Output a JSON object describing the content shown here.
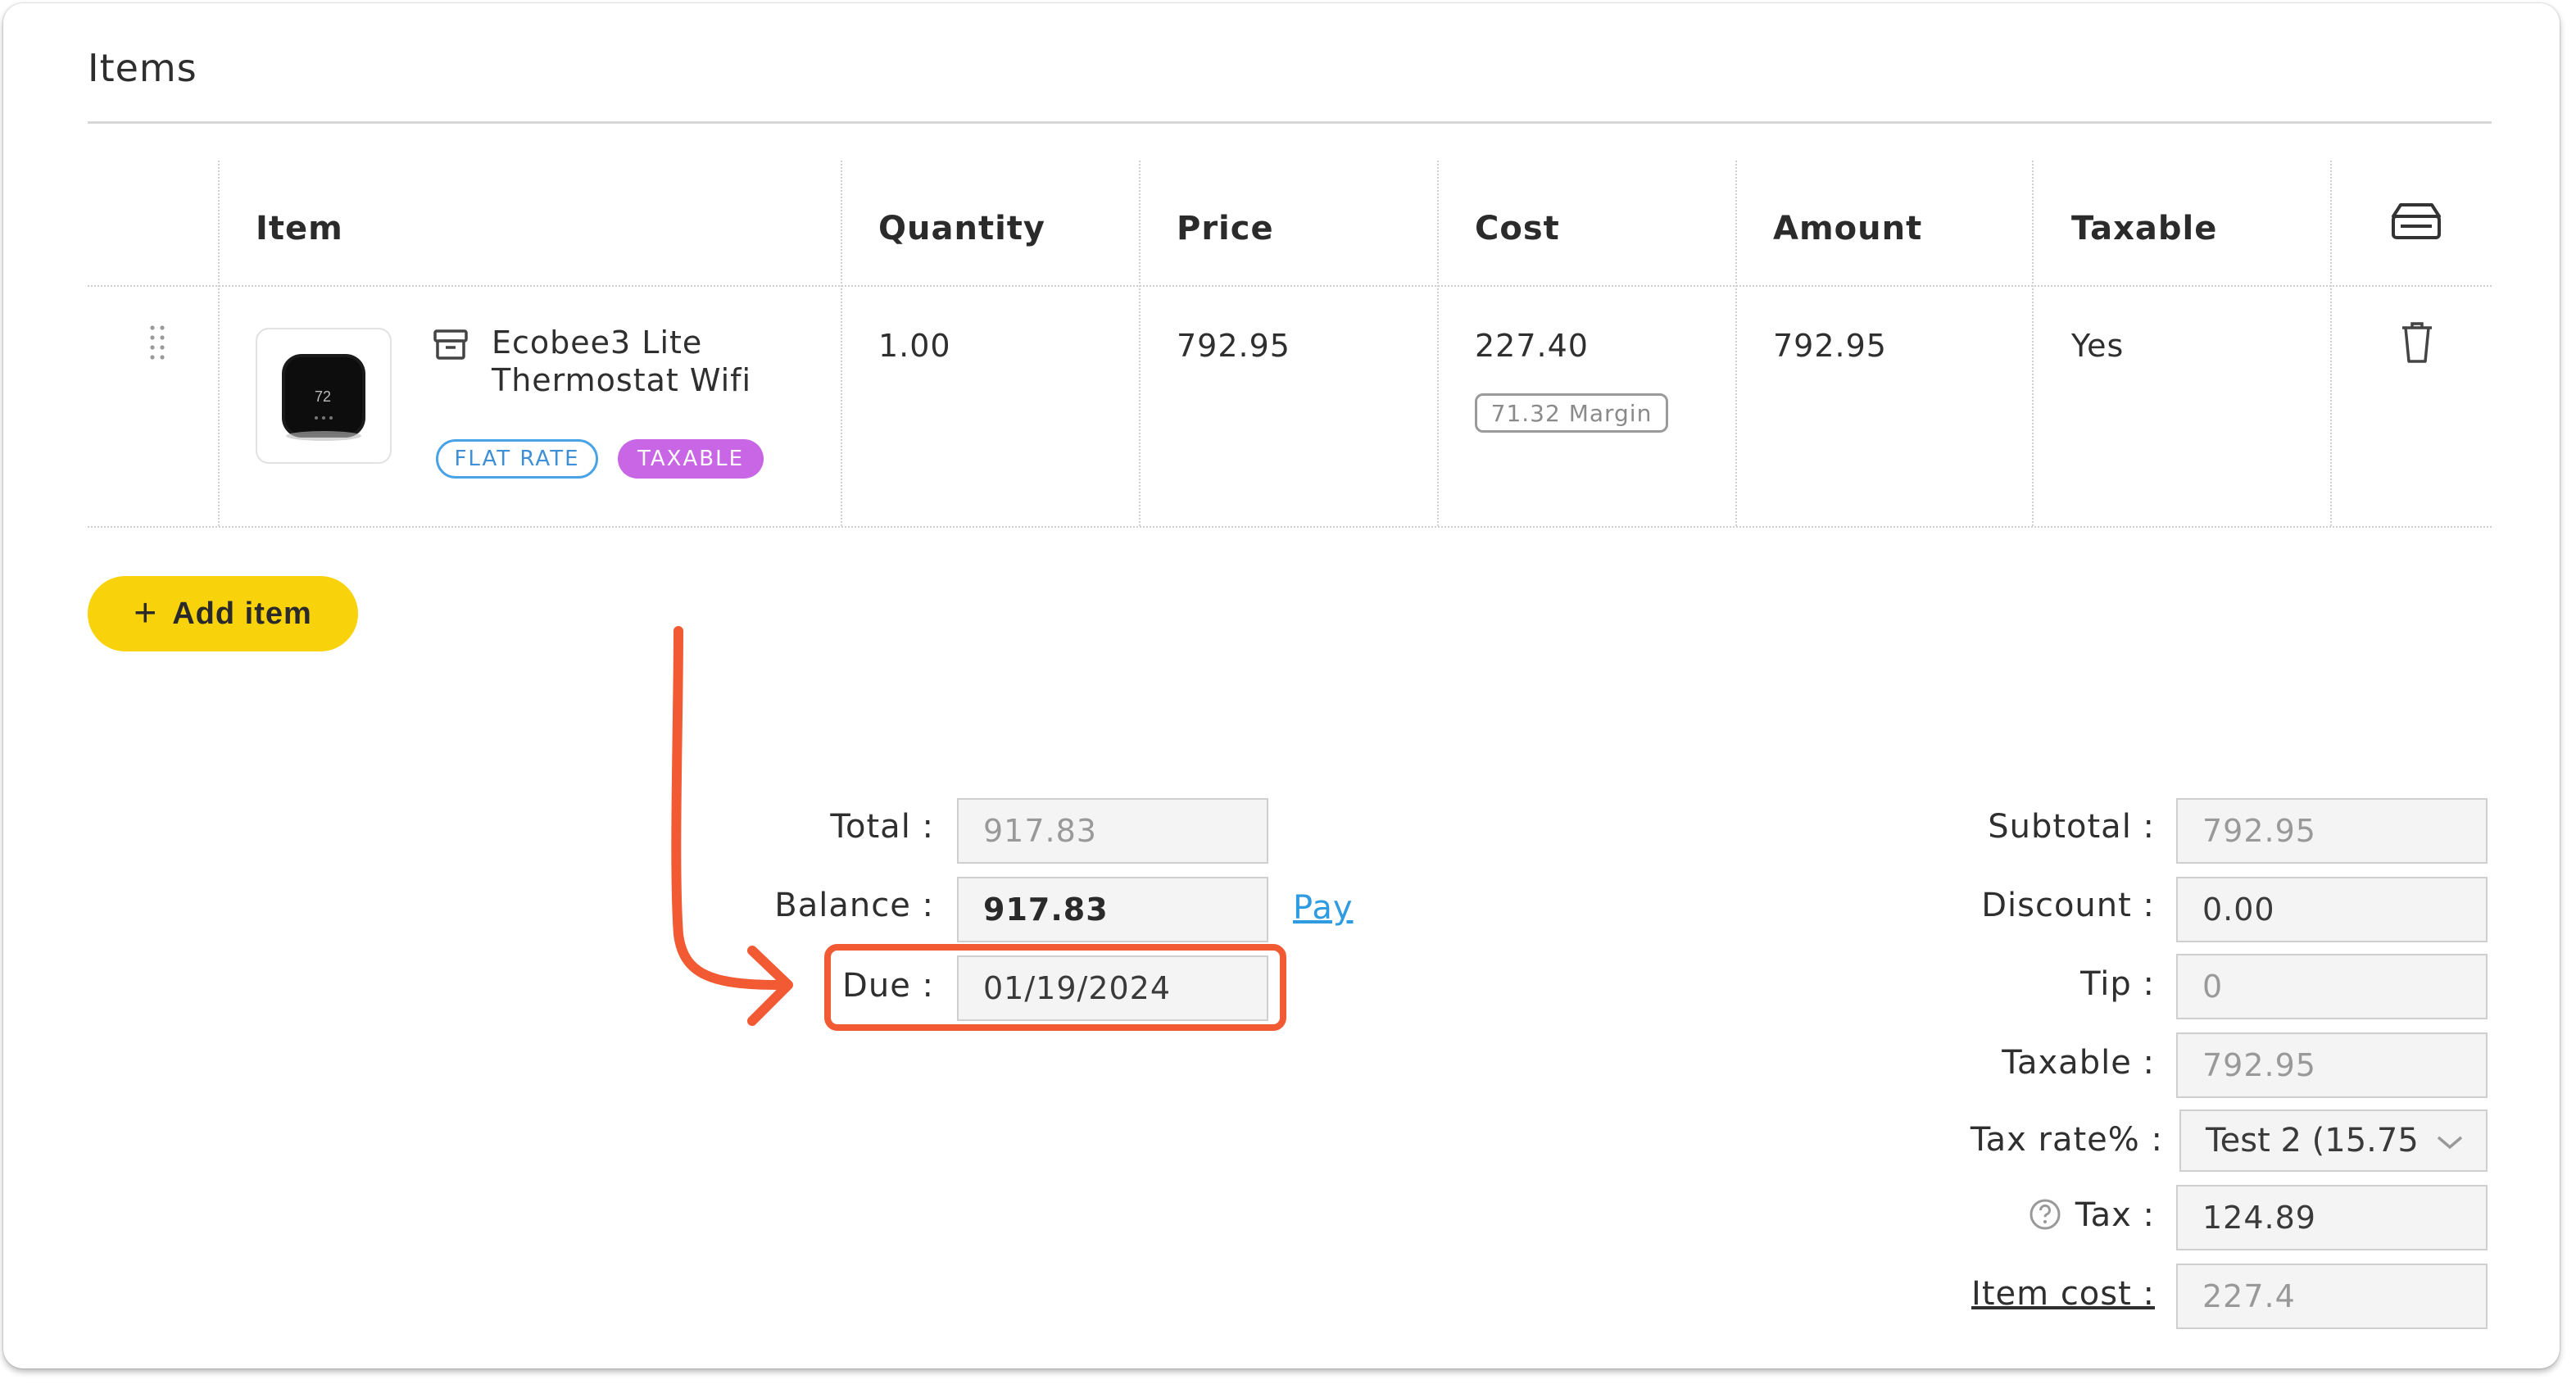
{
  "section": {
    "title": "Items"
  },
  "table": {
    "headers": {
      "item": "Item",
      "quantity": "Quantity",
      "price": "Price",
      "cost": "Cost",
      "amount": "Amount",
      "taxable": "Taxable"
    },
    "rows": [
      {
        "name_line1": "Ecobee3 Lite",
        "name_line2": "Thermostat Wifi",
        "thumbnail_text": "72",
        "tags": [
          "FLAT RATE",
          "TAXABLE"
        ],
        "quantity": "1.00",
        "price": "792.95",
        "cost": "227.40",
        "margin": "71.32 Margin",
        "amount": "792.95",
        "taxable": "Yes"
      }
    ]
  },
  "actions": {
    "add_item": "Add item"
  },
  "payment": {
    "total_label": "Total :",
    "total_value": "917.83",
    "balance_label": "Balance :",
    "balance_value": "917.83",
    "pay_link": "Pay",
    "due_label": "Due :",
    "due_value": "01/19/2024"
  },
  "summary": {
    "subtotal_label": "Subtotal :",
    "subtotal_value": "792.95",
    "discount_label": "Discount :",
    "discount_value": "0.00",
    "tip_label": "Tip :",
    "tip_value": "0",
    "taxable_label": "Taxable :",
    "taxable_value": "792.95",
    "tax_rate_label": "Tax rate% :",
    "tax_rate_value": "Test 2 (15.75",
    "tax_label": "Tax :",
    "tax_value": "124.89",
    "item_cost_label": "Item cost :",
    "item_cost_value": "227.4"
  },
  "colors": {
    "accent_yellow": "#f8d20b",
    "highlight_orange": "#f25a34",
    "link_blue": "#2f9be0",
    "tag_blue": "#4aa3e6",
    "tag_purple": "#c866e6"
  },
  "icons": {
    "header_right": "tray-icon",
    "row_delete": "trash-icon",
    "row_type": "inventory-box-icon",
    "drag": "drag-handle-icon",
    "help": "question-circle-icon",
    "select": "chevron-down-icon",
    "annotation": "arrow-annotation"
  }
}
